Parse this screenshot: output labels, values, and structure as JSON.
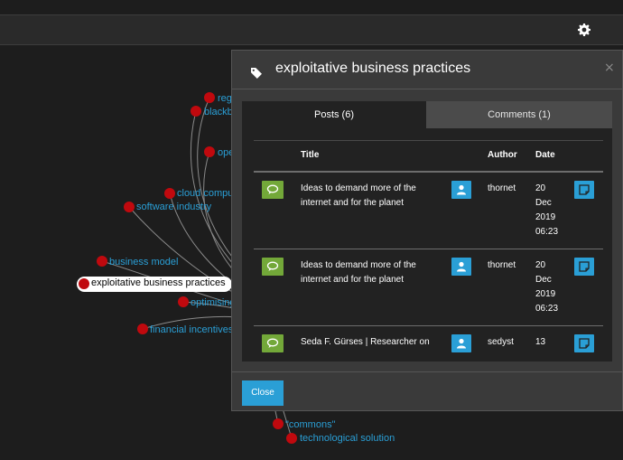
{
  "graph": {
    "selected_node": "exploitative business practices",
    "nodes": [
      {
        "label": "reg"
      },
      {
        "label": "blackb"
      },
      {
        "label": "ope"
      },
      {
        "label": "cloud compu"
      },
      {
        "label": "software industry"
      },
      {
        "label": "business model"
      },
      {
        "label": "optimising"
      },
      {
        "label": "financial incentives"
      },
      {
        "label": "\"commons\""
      },
      {
        "label": "technological solution"
      }
    ]
  },
  "modal": {
    "title": "exploitative business practices",
    "close_symbol": "×",
    "tabs": [
      {
        "label": "Posts (6)",
        "active": true
      },
      {
        "label": "Comments (1)",
        "active": false
      }
    ],
    "columns": [
      "Title",
      "Author",
      "Date"
    ],
    "rows": [
      {
        "title_line1": "Ideas to demand more of the",
        "title_line2": "internet and for the planet",
        "author": "thornet",
        "date_line1": "20",
        "date_line2": "Dec",
        "date_line3": "2019",
        "date_line4": "06:23"
      },
      {
        "title_line1": "Ideas to demand more of the",
        "title_line2": "internet and for the planet",
        "author": "thornet",
        "date_line1": "20",
        "date_line2": "Dec",
        "date_line3": "2019",
        "date_line4": "06:23"
      },
      {
        "title_line1": "Seda F. Gürses | Researcher on",
        "title_line2": "",
        "author": "sedyst",
        "date_line1": "13",
        "date_line2": "",
        "date_line3": "",
        "date_line4": ""
      }
    ],
    "close_button": "Close"
  },
  "icons": {
    "settings": "gear-icon",
    "tag": "tag-icon",
    "comment": "comment-icon",
    "user": "user-icon",
    "note": "note-icon"
  },
  "colors": {
    "accent": "#2a9fd6",
    "success": "#73a839",
    "node": "#c0090e"
  }
}
